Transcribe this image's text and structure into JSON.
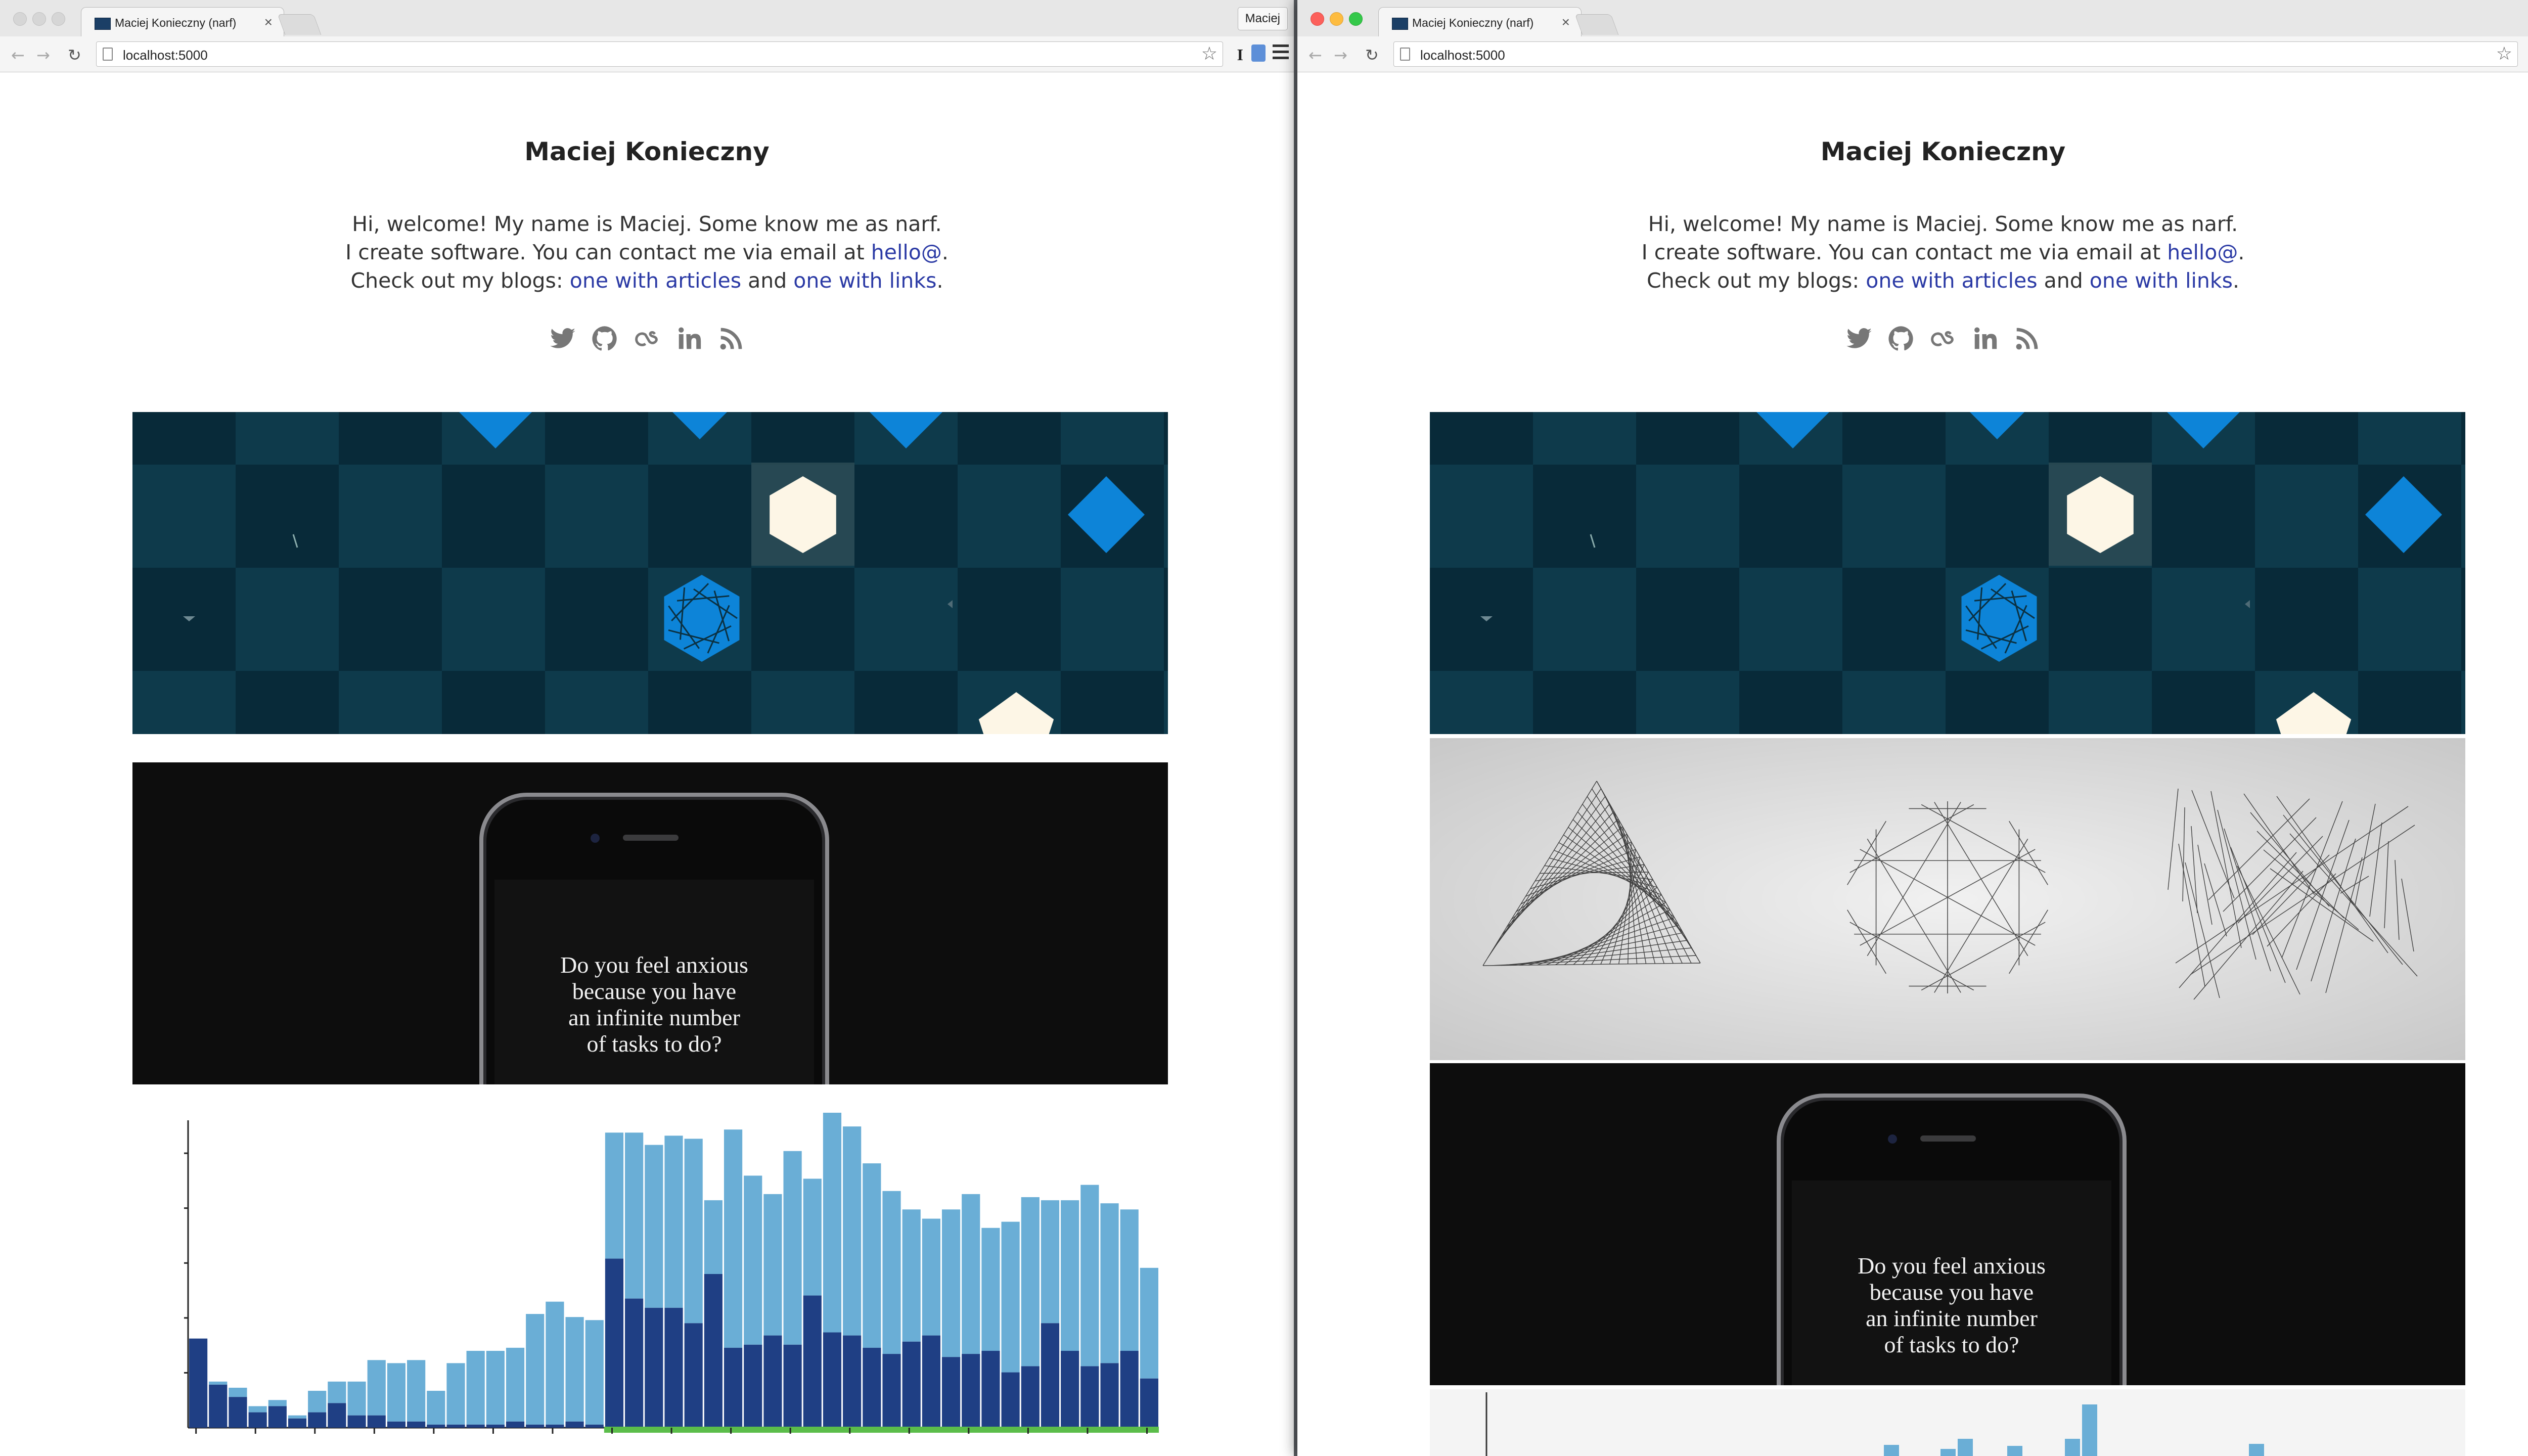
{
  "browser": {
    "tab_title": "Maciej Konieczny (narf)",
    "tab_close": "×",
    "profile_name": "Maciej",
    "url": "localhost:5000",
    "back_glyph": "←",
    "forward_glyph": "→",
    "reload_glyph": "↻",
    "star_glyph": "☆",
    "extension_label": "I"
  },
  "site": {
    "title": "Maciej Konieczny",
    "intro_line1": "Hi, welcome! My name is Maciej. Some know me as narf.",
    "intro_line2_prefix": "I create software. You can contact me via email at ",
    "email_link": "hello@",
    "intro_line2_suffix": ".",
    "intro_line3_prefix": "Check out my blogs: ",
    "blog_articles_link": "one with articles",
    "intro_line3_middle": " and ",
    "blog_links_link": "one with links",
    "intro_line3_suffix": ".",
    "social_icons": [
      "twitter-icon",
      "github-icon",
      "lastfm-icon",
      "linkedin-icon",
      "rss-icon"
    ]
  },
  "phone_text": {
    "line1": "Do you feel anxious",
    "line2": "because you have",
    "line3": "an infinite number",
    "line4": "of tasks to do?"
  },
  "colors": {
    "link": "#2b3aa5",
    "grid_bg": "#0b3142",
    "diamond": "#0d84d8",
    "hexagon": "#fdf6e6",
    "bar_dark": "#1f3f84",
    "bar_light": "#6aaed6",
    "timeline_green": "#5bbd4a",
    "traffic_red": "#fc605b",
    "traffic_yellow": "#fdbc40",
    "traffic_green": "#34c84a"
  },
  "chart_data": {
    "type": "bar",
    "stacked": true,
    "series": [
      {
        "values": [
          29,
          14,
          10,
          5,
          7,
          3,
          5,
          8,
          4,
          4,
          2,
          2,
          1,
          1,
          1,
          1,
          2,
          1,
          1,
          2,
          1,
          55,
          42,
          39,
          39,
          34,
          50,
          26,
          27,
          30,
          27,
          43,
          31,
          30,
          26,
          24,
          28,
          30,
          23,
          24,
          25,
          18,
          20,
          34,
          25,
          20,
          21,
          25,
          16
        ]
      },
      {
        "values": [
          0,
          1,
          3,
          2,
          2,
          1,
          7,
          7,
          11,
          18,
          19,
          20,
          11,
          20,
          24,
          24,
          24,
          36,
          40,
          34,
          34,
          41,
          54,
          53,
          56,
          60,
          24,
          71,
          55,
          46,
          63,
          38,
          78,
          68,
          60,
          53,
          43,
          38,
          48,
          52,
          40,
          49,
          55,
          40,
          49,
          59,
          52,
          46,
          36
        ]
      }
    ],
    "y_range": [
      0,
      100
    ],
    "x_range": [
      0,
      49
    ]
  }
}
